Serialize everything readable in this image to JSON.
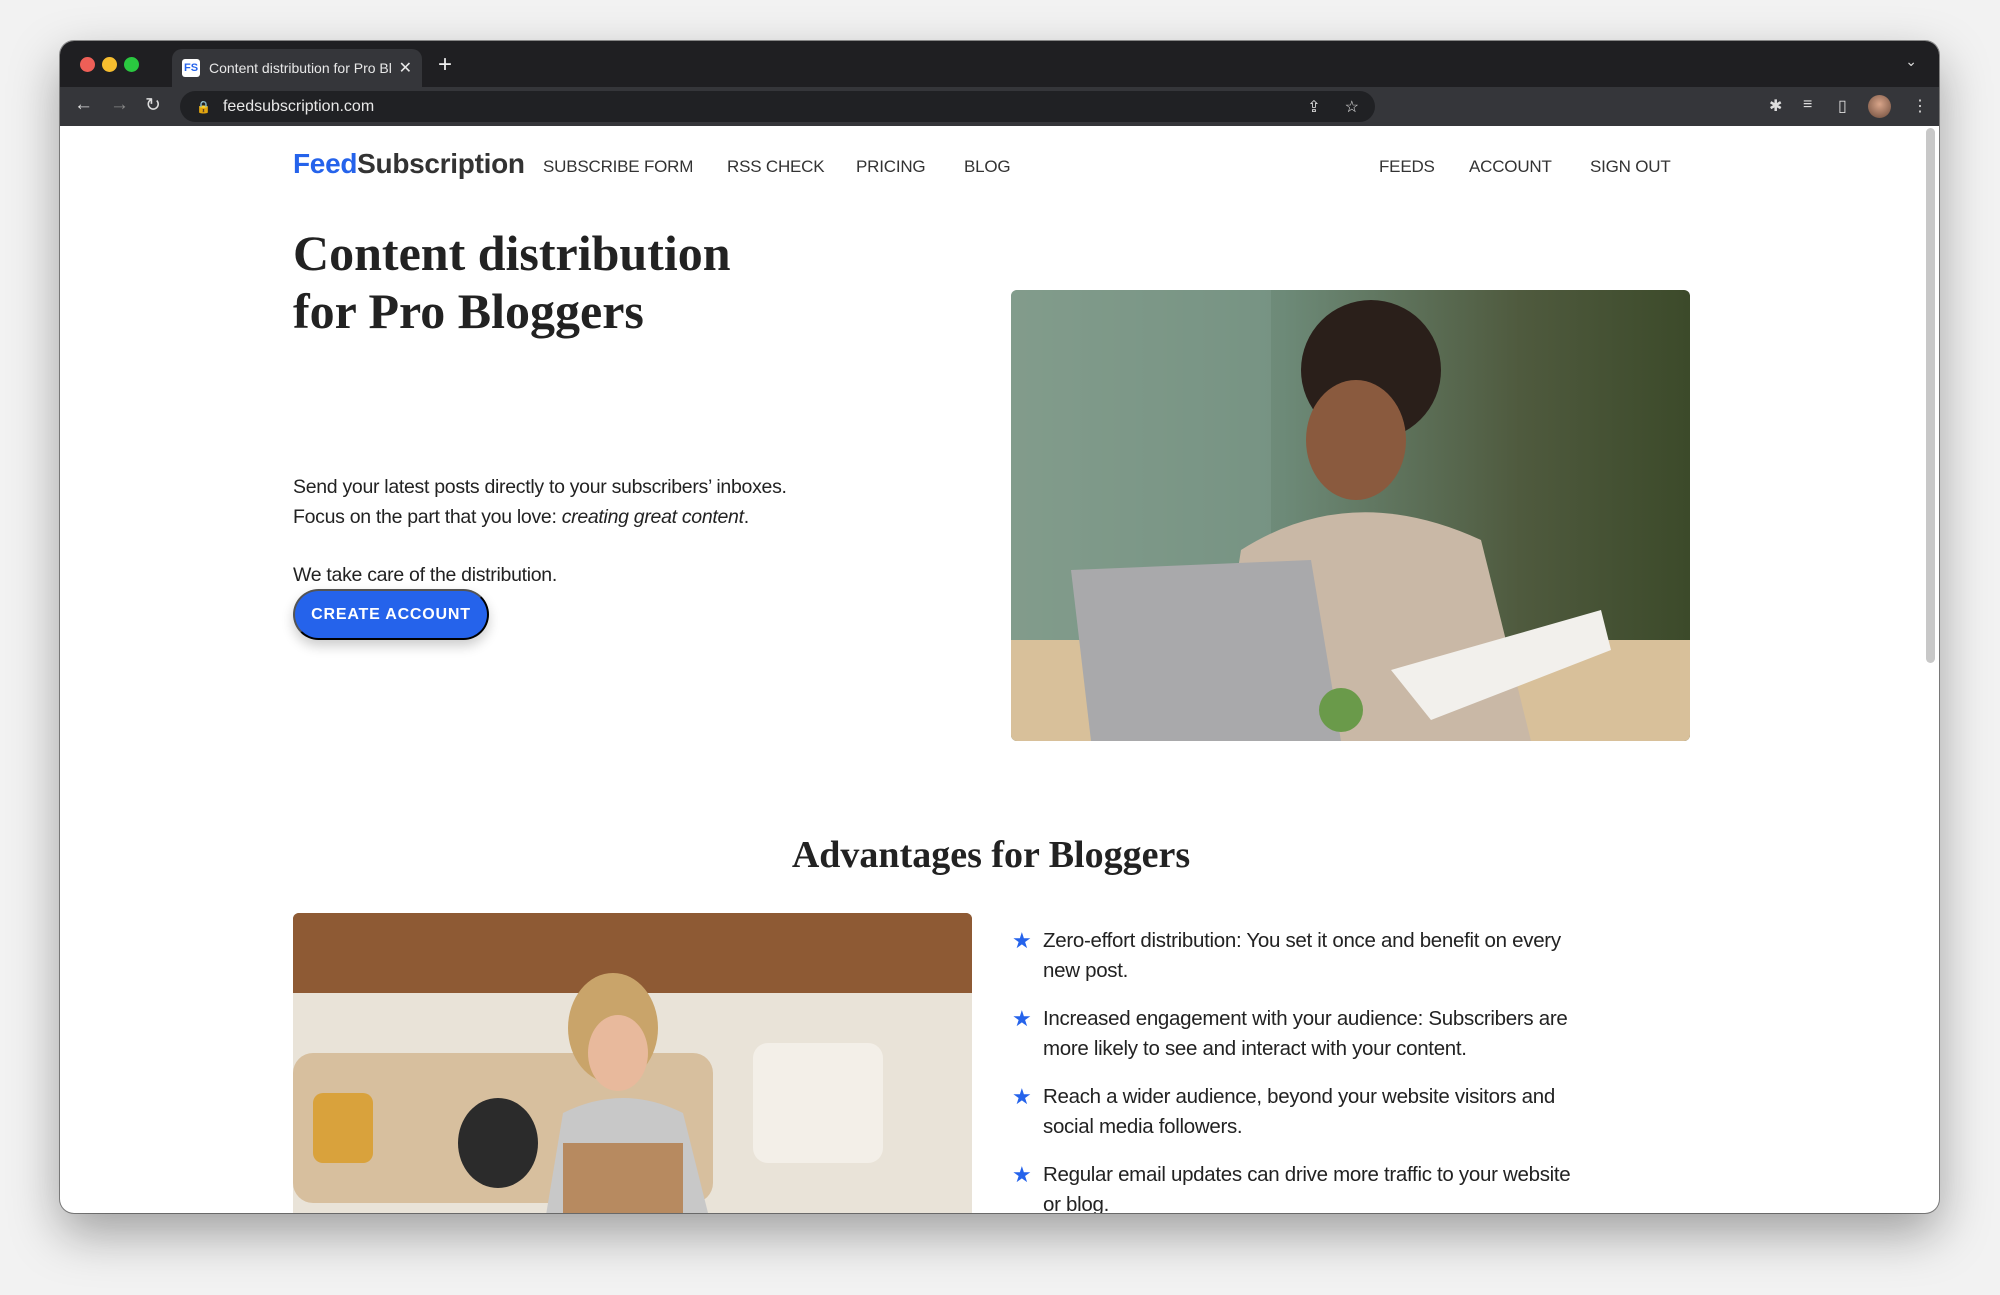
{
  "browser": {
    "tab_title": "Content distribution for Pro Bloggers",
    "favicon": "FS",
    "url": "feedsubscription.com",
    "icons": [
      "back-icon",
      "forward-icon",
      "reload-icon",
      "lock-icon",
      "share-icon",
      "star-icon",
      "extensions-icon",
      "media-icon",
      "sidepanel-icon",
      "avatar",
      "menu-icon"
    ]
  },
  "header": {
    "logo_a": "Feed",
    "logo_b": "Subscription",
    "nav_left": [
      "SUBSCRIBE FORM",
      "RSS CHECK",
      "PRICING",
      "BLOG"
    ],
    "nav_right": [
      "FEEDS",
      "ACCOUNT",
      "SIGN OUT"
    ]
  },
  "hero": {
    "title_line1": "Content distribution",
    "title_line2": "for Pro Bloggers",
    "p1_line1": "Send your latest posts directly to your subscribers’ inboxes.",
    "p1_line2_a": "Focus on the part that you love: ",
    "p1_line2_em": "creating great content",
    "p1_line2_b": ".",
    "p2": "We take care of the distribution.",
    "cta": "CREATE ACCOUNT"
  },
  "advantages": {
    "title": "Advantages for Bloggers",
    "items": [
      "Zero-effort distribution: You set it once and benefit on every new post.",
      "Increased engagement with your audience: Subscribers are more likely to see and interact with your content.",
      "Reach a wider audience, beyond your website visitors and social media followers.",
      "Regular email updates can drive more traffic to your website or blog."
    ]
  },
  "colors": {
    "accent": "#2563eb",
    "text": "#222222"
  }
}
